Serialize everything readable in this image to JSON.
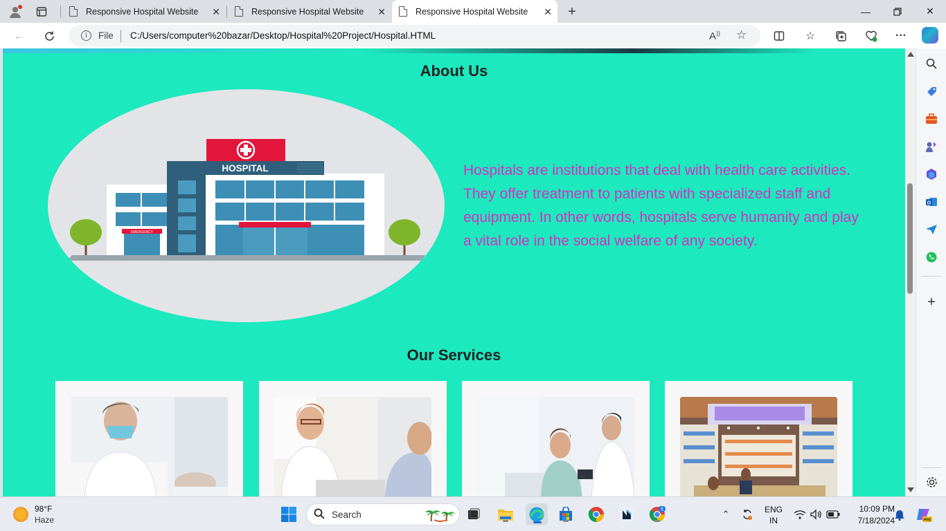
{
  "browser": {
    "tabs": [
      {
        "title": "Responsive Hospital Website",
        "active": false
      },
      {
        "title": "Responsive Hospital Website",
        "active": false
      },
      {
        "title": "Responsive Hospital Website",
        "active": true
      }
    ],
    "address": {
      "scheme_label": "File",
      "url": "C:/Users/computer%20bazar/Desktop/Hospital%20Project/Hospital.HTML"
    }
  },
  "page": {
    "about": {
      "heading": "About Us",
      "sign_text": "HOSPITAL",
      "emergency_text": "EMERGENCY",
      "paragraph": "Hospitals are institutions that deal with health care activities. They offer treatment to patients with specialized staff and equipment. In other words, hospitals serve humanity and play a vital role in the social welfare of any society."
    },
    "services": {
      "heading": "Our Services",
      "cards": [
        {
          "image": "nurse-with-mask-and-patient-photo"
        },
        {
          "image": "doctor-consultation-photo"
        },
        {
          "image": "doctor-checking-blood-pressure-photo"
        },
        {
          "image": "pharmacy-store-photo"
        }
      ]
    }
  },
  "taskbar": {
    "weather": {
      "temp": "98°F",
      "desc": "Haze"
    },
    "search_label": "Search",
    "language": {
      "line1": "ENG",
      "line2": "IN"
    },
    "clock": {
      "time": "10:09 PM",
      "date": "7/18/2024"
    }
  },
  "colors": {
    "page_background": "#1ce9be",
    "about_text": "#d52fc0",
    "hospital_sign_red": "#e3153a",
    "building_blue": "#2f5f7a"
  }
}
